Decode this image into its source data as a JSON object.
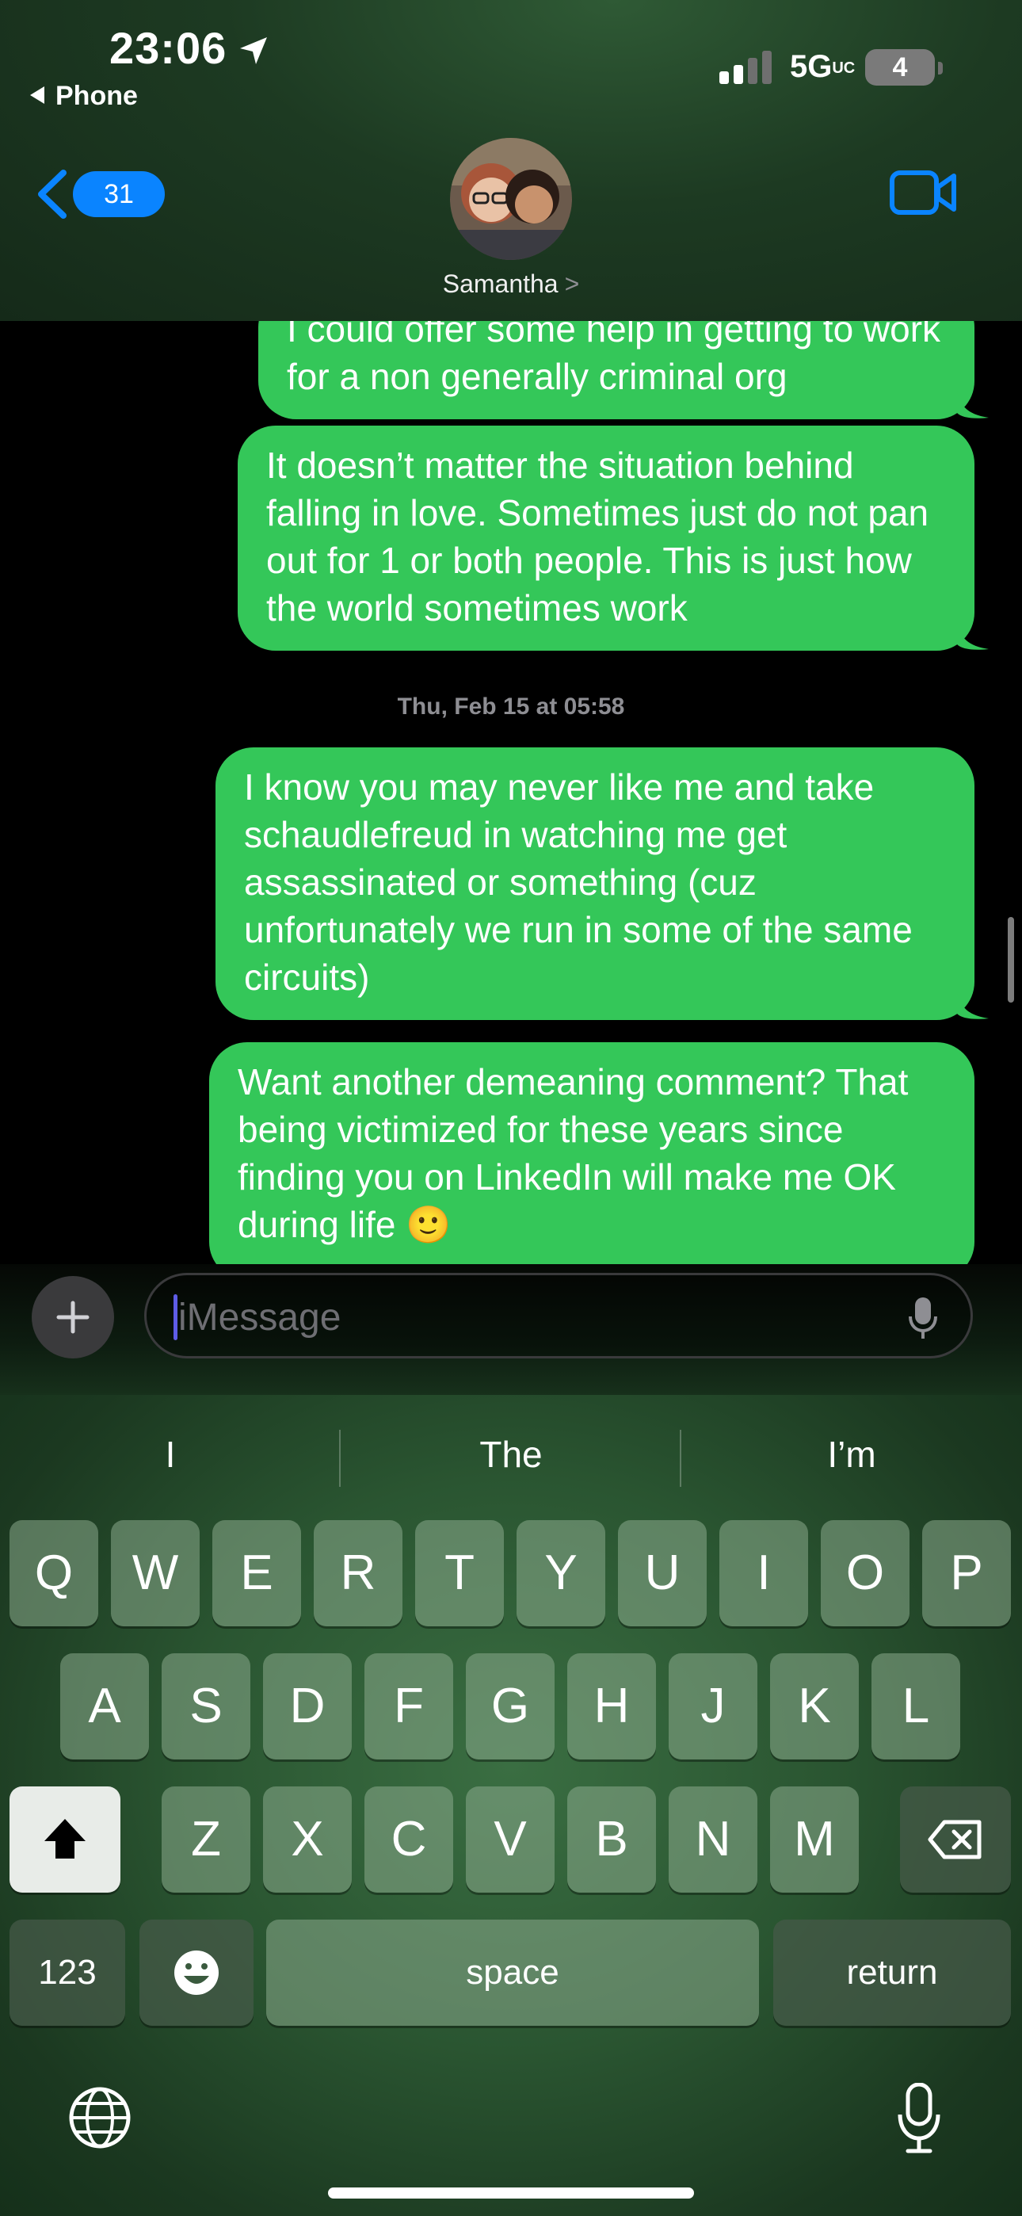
{
  "status_bar": {
    "time": "23:06",
    "back_app": "Phone",
    "network": "5G",
    "network_suffix": "UC",
    "battery": "4"
  },
  "header": {
    "back_badge": "31",
    "contact_name": "Samantha",
    "contact_chevron": ">",
    "icons": [
      "back-chevron-icon",
      "facetime-video-icon"
    ]
  },
  "conversation": {
    "messages": [
      {
        "text": "I could offer some help in getting to work for a non generally criminal org"
      },
      {
        "text": "It doesn’t matter the situation behind falling in love. Sometimes just do not pan out for 1 or both people. This is just how the world sometimes work"
      },
      {
        "text": "I know you may never like me and take schaudlefreud in watching me get assassinated or something (cuz unfortunately we run in some of the same circuits)"
      },
      {
        "text": "Want another demeaning comment? That being victimized for these years since finding you on LinkedIn will make me OK during life 🙂"
      }
    ],
    "timestamp": "Thu, Feb 15 at 05:58"
  },
  "input": {
    "placeholder": "iMessage"
  },
  "keyboard": {
    "predictions": [
      "I",
      "The",
      "I’m"
    ],
    "row1": [
      "Q",
      "W",
      "E",
      "R",
      "T",
      "Y",
      "U",
      "I",
      "O",
      "P"
    ],
    "row2": [
      "A",
      "S",
      "D",
      "F",
      "G",
      "H",
      "J",
      "K",
      "L"
    ],
    "row3": [
      "Z",
      "X",
      "C",
      "V",
      "B",
      "N",
      "M"
    ],
    "numbers_key": "123",
    "space_key": "space",
    "return_key": "return"
  },
  "colors": {
    "bubble": "#34c759",
    "accent": "#0a84ff",
    "background": "#000000"
  }
}
